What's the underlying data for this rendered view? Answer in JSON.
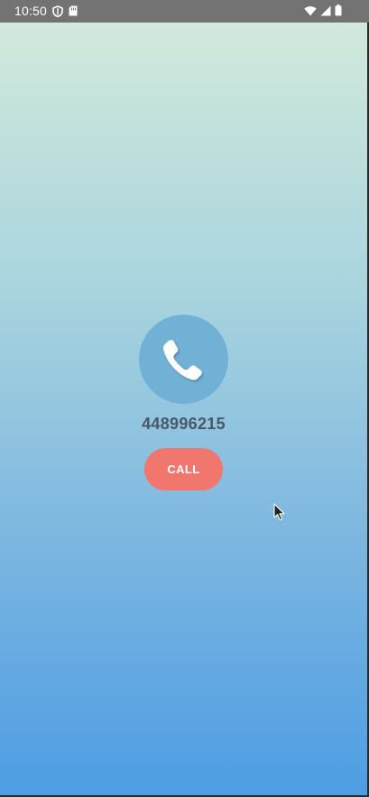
{
  "status_bar": {
    "time": "10:50",
    "icons": [
      "shield-icon",
      "sim-card-icon",
      "wifi-icon",
      "signal-icon",
      "battery-icon"
    ]
  },
  "main": {
    "phone_number": "448996215",
    "call_button_label": "CALL",
    "phone_icon": "phone-handset-icon"
  },
  "colors": {
    "gradient_top": "#d1e9db",
    "gradient_bottom": "#4d9de3",
    "icon_circle": "#72b1d6",
    "call_button": "#f1766e",
    "phone_number_text": "#4a5866",
    "status_bar": "#737373"
  }
}
